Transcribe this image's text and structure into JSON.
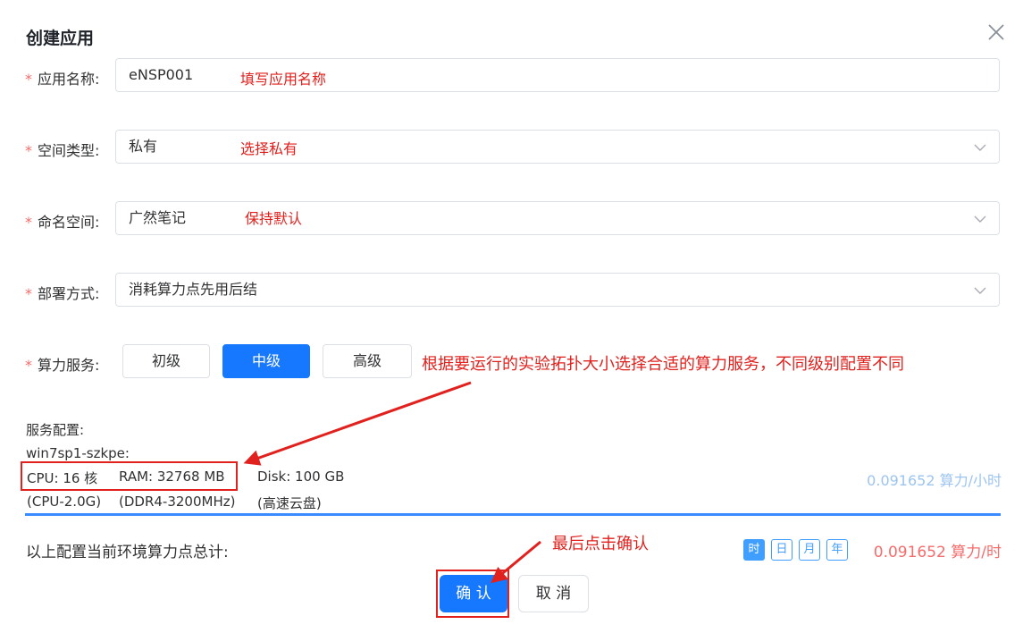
{
  "dialog": {
    "title": "创建应用",
    "close_icon": "close-icon"
  },
  "form": {
    "required_mark": "*",
    "app_name": {
      "label": "应用名称:",
      "value": "eNSP001",
      "annotation": "填写应用名称"
    },
    "space_type": {
      "label": "空间类型:",
      "value": "私有",
      "annotation": "选择私有"
    },
    "namespace": {
      "label": "命名空间:",
      "value": "广然笔记",
      "annotation": "保持默认"
    },
    "deploy_mode": {
      "label": "部署方式:",
      "value": "消耗算力点先用后结"
    },
    "compute_service": {
      "label": "算力服务:",
      "levels": [
        "初级",
        "中级",
        "高级"
      ],
      "selected": "中级",
      "annotation": "根据要运行的实验拓扑大小选择合适的算力服务，不同级别配置不同"
    }
  },
  "config": {
    "title": "服务配置:",
    "image": "win7sp1-szkpe:",
    "cpu": "CPU: 16 核",
    "ram": "RAM: 32768 MB",
    "disk": "Disk: 100 GB",
    "cpu_detail": "(CPU-2.0G)",
    "ram_detail": "(DDR4-3200MHz)",
    "disk_detail": "(高速云盘)",
    "price": "0.091652 算力/小时"
  },
  "total": {
    "label": "以上配置当前环境算力点总计:",
    "units": [
      "时",
      "日",
      "月",
      "年"
    ],
    "selected_unit": "时",
    "price": "0.091652 算力/时"
  },
  "actions": {
    "confirm": "确 认",
    "cancel": "取 消",
    "annotation": "最后点击确认"
  },
  "colors": {
    "primary": "#1677ff",
    "annotation_red": "#e0211d",
    "price_red": "#f56c6c",
    "price_blue": "#9cc4f0"
  }
}
